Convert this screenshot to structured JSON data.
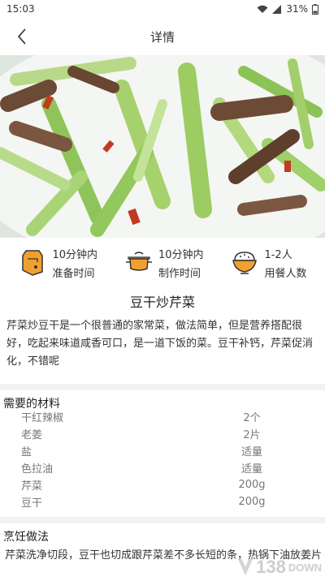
{
  "status_bar": {
    "time": "15:03",
    "battery": "31%"
  },
  "nav": {
    "title": "详情"
  },
  "info": [
    {
      "value": "10分钟内",
      "label": "准备时间",
      "icon": "timer-icon"
    },
    {
      "value": "10分钟内",
      "label": "制作时间",
      "icon": "pot-icon"
    },
    {
      "value": "1-2人",
      "label": "用餐人数",
      "icon": "rice-bowl-icon"
    }
  ],
  "dish": {
    "title": "豆干炒芹菜",
    "description": "芹菜炒豆干是一个很普通的家常菜，做法简单，但是营养搭配很好，吃起来味道咸香可口，是一道下饭的菜。豆干补钙，芹菜促消化，不错呢"
  },
  "ingredients": {
    "title": "需要的材料",
    "items": [
      {
        "name": "干红辣椒",
        "qty": "2个"
      },
      {
        "name": "老姜",
        "qty": "2片"
      },
      {
        "name": "盐",
        "qty": "适量"
      },
      {
        "name": "色拉油",
        "qty": "适量"
      },
      {
        "name": "芹菜",
        "qty": "200g"
      },
      {
        "name": "豆干",
        "qty": "200g"
      }
    ]
  },
  "cooking": {
    "title": "烹饪做法",
    "first_line": "芹菜洗净切段，豆干也切成跟芹菜差不多长短的条，热锅下油放姜片"
  },
  "watermark": {
    "number": "138",
    "suffix": "DOWN"
  },
  "colors": {
    "accent_orange": "#f0a030",
    "icon_outline": "#333333",
    "divider": "#f2f2f2",
    "muted_text": "#777777"
  }
}
